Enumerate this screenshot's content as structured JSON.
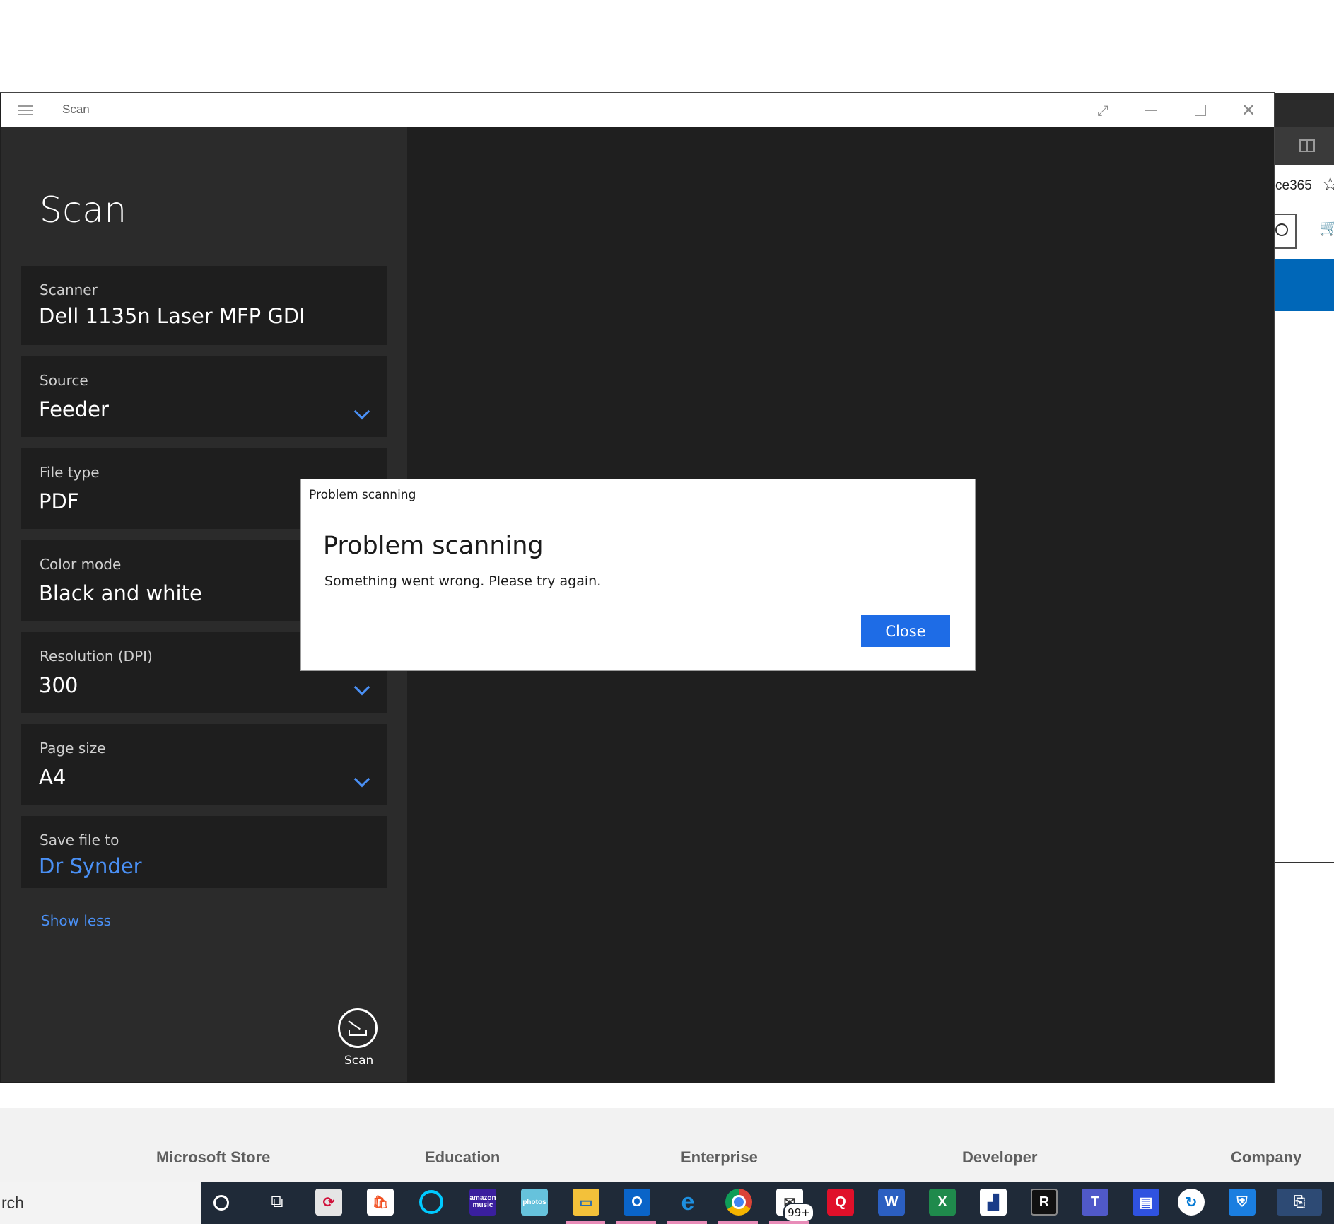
{
  "background_page": {
    "address_fragment": "ce365",
    "footer": [
      "Microsoft Store",
      "Education",
      "Enterprise",
      "Developer",
      "Company"
    ]
  },
  "taskbar": {
    "search_fragment": "rch",
    "mail_badge": "99+",
    "amazon_music_label": "amazon music",
    "amazon_photos_label": "photos"
  },
  "window": {
    "title": "Scan"
  },
  "pane": {
    "title": "Scan",
    "scanner": {
      "label": "Scanner",
      "value": "Dell 1135n Laser MFP GDI"
    },
    "source": {
      "label": "Source",
      "value": "Feeder"
    },
    "file_type": {
      "label": "File type",
      "value": "PDF"
    },
    "color_mode": {
      "label": "Color mode",
      "value": "Black and white"
    },
    "resolution": {
      "label": "Resolution (DPI)",
      "value": "300"
    },
    "page_size": {
      "label": "Page size",
      "value": "A4"
    },
    "save_to": {
      "label": "Save file to",
      "value": "Dr Synder"
    },
    "show_less": "Show less",
    "scan_button": "Scan"
  },
  "dialog": {
    "caption": "Problem scanning",
    "title": "Problem scanning",
    "message": "Something went wrong. Please try again.",
    "close_label": "Close"
  },
  "colors": {
    "accent": "#1e6ce6",
    "link": "#4a90f5",
    "taskbar": "#1f2a38"
  }
}
